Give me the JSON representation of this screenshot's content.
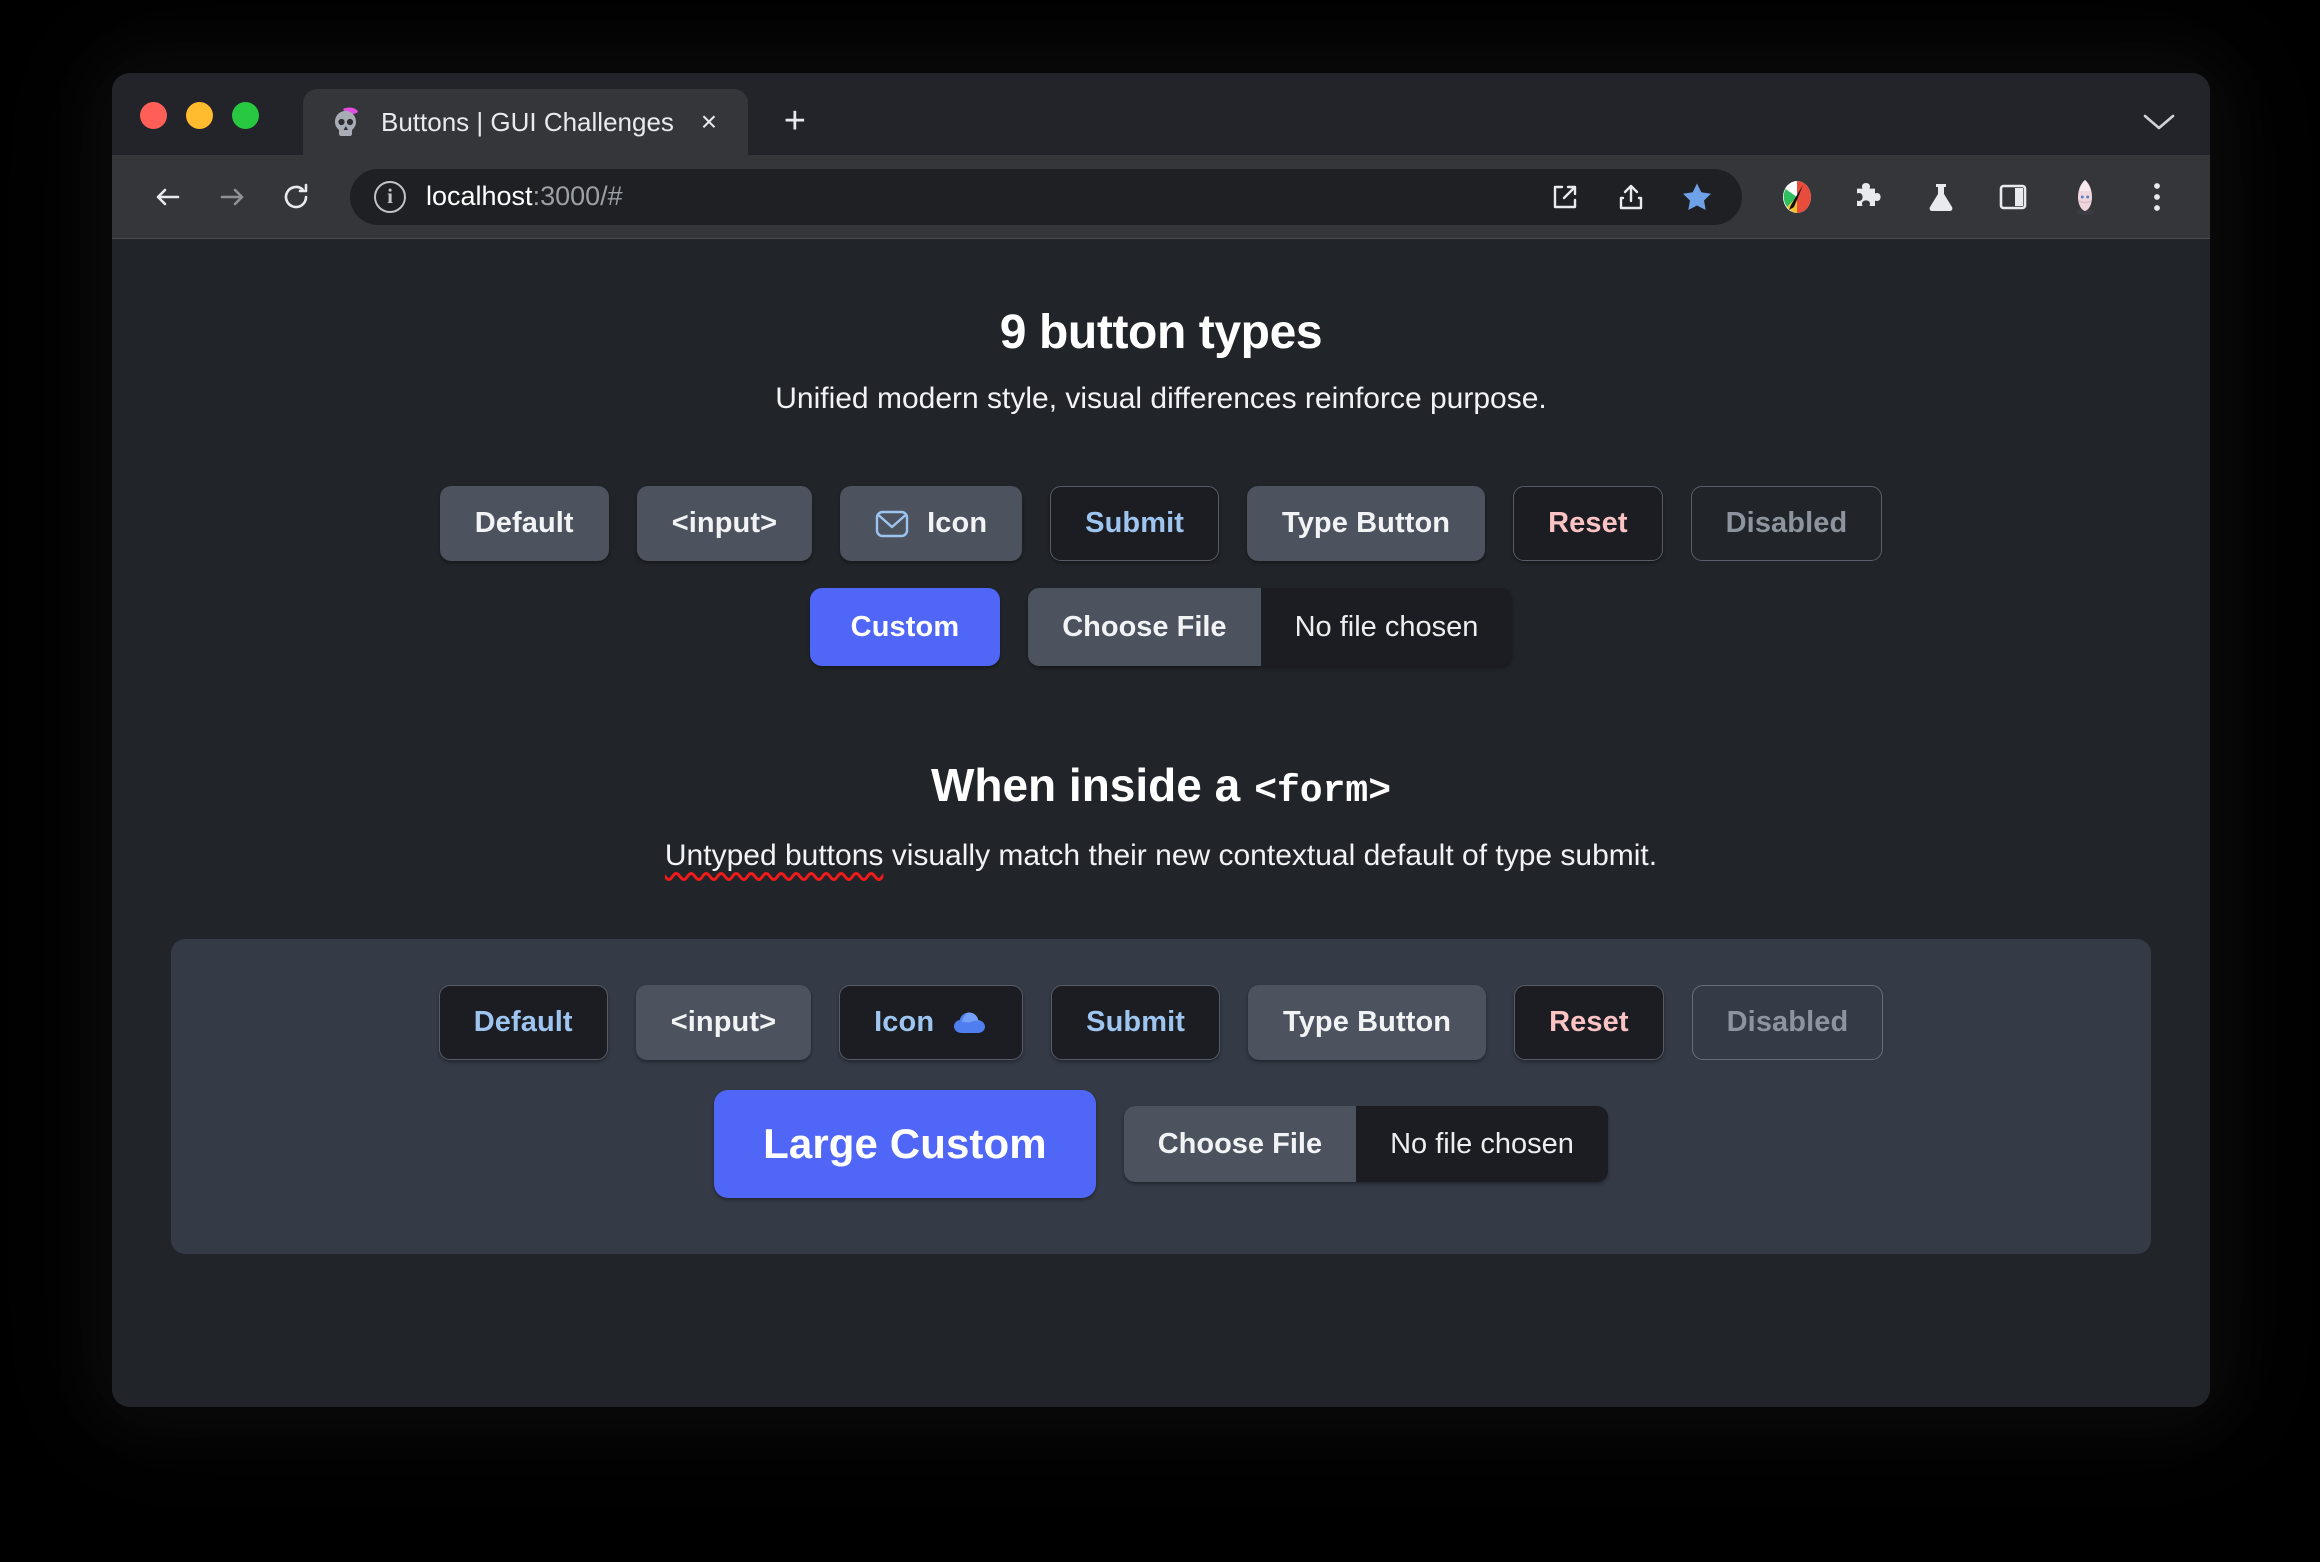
{
  "browser": {
    "tab": {
      "title": "Buttons | GUI Challenges",
      "favicon_name": "skull-favicon",
      "close_label": "×"
    },
    "new_tab_label": "+",
    "tabstrip_menu_label": "⌄",
    "toolbar": {
      "back_label": "←",
      "forward_label": "→",
      "reload_label": "↻",
      "url_host": "localhost",
      "url_rest": ":3000/#",
      "omnibox_actions": [
        "open-in-new-icon",
        "share-icon",
        "bookmark-star-icon"
      ],
      "extensions": [
        "color-picker-icon",
        "puzzle-extensions-icon",
        "flask-labs-icon",
        "side-panel-icon",
        "profile-avatar-icon",
        "kebab-menu-icon"
      ]
    }
  },
  "page": {
    "section1": {
      "title": "9 button types",
      "subtitle": "Unified modern style, visual differences reinforce purpose.",
      "row1": [
        {
          "label": "Default",
          "variant": "default"
        },
        {
          "label": "<input>",
          "variant": "inputlike"
        },
        {
          "label": "Icon",
          "variant": "icon",
          "icon": "envelope-icon",
          "icon_position": "left"
        },
        {
          "label": "Submit",
          "variant": "submit"
        },
        {
          "label": "Type Button",
          "variant": "typebtn"
        },
        {
          "label": "Reset",
          "variant": "reset"
        },
        {
          "label": "Disabled",
          "variant": "disabled"
        }
      ],
      "custom_label": "Custom",
      "file": {
        "button_label": "Choose File",
        "status_label": "No file chosen"
      }
    },
    "section2": {
      "title_text": "When inside a",
      "title_mono": "<form>",
      "subtitle_spellchecked": "Untyped buttons",
      "subtitle_rest": " visually match their new contextual default of type submit.",
      "row1": [
        {
          "label": "Default",
          "variant": "default"
        },
        {
          "label": "<input>",
          "variant": "inputlike"
        },
        {
          "label": "Icon",
          "variant": "icon",
          "icon": "cloud-icon",
          "icon_position": "right"
        },
        {
          "label": "Submit",
          "variant": "submit"
        },
        {
          "label": "Type Button",
          "variant": "typebtn"
        },
        {
          "label": "Reset",
          "variant": "reset"
        },
        {
          "label": "Disabled",
          "variant": "disabled"
        }
      ],
      "custom_label": "Large Custom",
      "file": {
        "button_label": "Choose File",
        "status_label": "No file chosen"
      }
    }
  },
  "colors": {
    "page_bg": "#212429",
    "surface": "#4c525e",
    "form_bg": "#343a46",
    "accent_blue": "#4f66f6",
    "submit_text": "#9ec5f0",
    "reset_text": "#fbc3c3",
    "disabled_text": "#8d949e",
    "traffic_red": "#ff5f57",
    "traffic_yellow": "#febc2e",
    "traffic_green": "#28c840",
    "spellcheck_red": "#ef1a1a"
  }
}
